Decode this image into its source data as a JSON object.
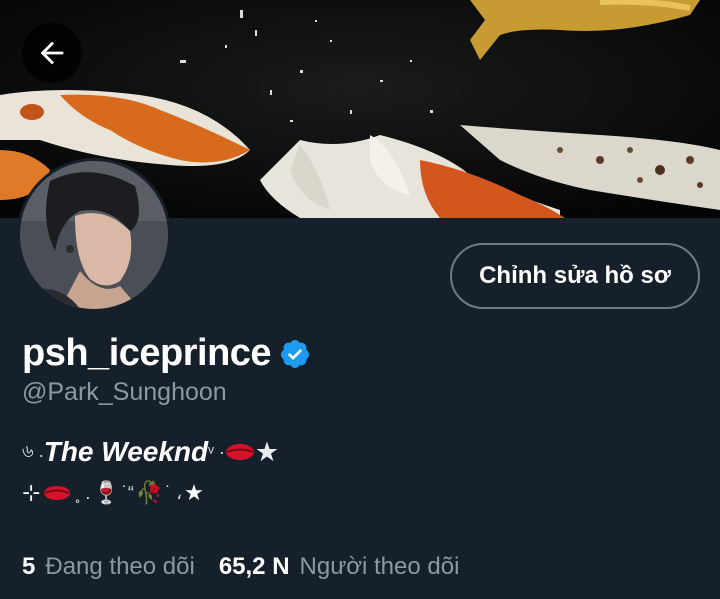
{
  "header": {
    "back_icon": "arrow-left-icon"
  },
  "profile": {
    "edit_button_label": "Chỉnh sửa hồ sơ",
    "display_name": "psh_iceprince",
    "verified_icon": "verified-badge-icon",
    "verified_color": "#1d9bf0",
    "handle": "@Park_Sunghoon",
    "bio_line1": {
      "prefix": "৬ .",
      "main": "The Weeknd",
      "suffix": "ᵛ · ",
      "star": "★"
    },
    "bio_line2": {
      "a": "⊹",
      "b": "˳ .",
      "wine": "🍷",
      "c": "˙“",
      "rose": "🥀",
      "d": "˙ ،",
      "star": "★"
    }
  },
  "stats": {
    "following_count": "5",
    "following_label": "Đang theo dõi",
    "followers_count": "65,2 N",
    "followers_label": "Người theo dõi"
  },
  "colors": {
    "background": "#15202b",
    "secondary_text": "#8b98a5",
    "button_border": "#6e7b87"
  }
}
